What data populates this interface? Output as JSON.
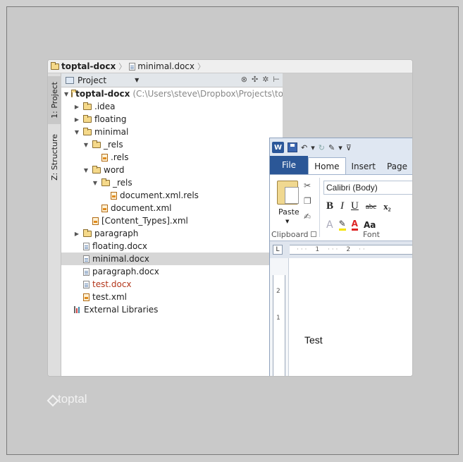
{
  "breadcrumb": {
    "project": "toptal-docx",
    "file": "minimal.docx"
  },
  "toolstrip": {
    "project_tab": "1: Project",
    "structure_tab": "Z: Structure"
  },
  "project_panel": {
    "title": "Project",
    "tree": [
      {
        "label": "toptal-docx",
        "path": "(C:\\Users\\steve\\Dropbox\\Projects\\topt",
        "kind": "folder",
        "expanded": true,
        "indent": 0
      },
      {
        "label": ".idea",
        "kind": "folder",
        "expanded": false,
        "indent": 1
      },
      {
        "label": "floating",
        "kind": "folder",
        "expanded": false,
        "indent": 1
      },
      {
        "label": "minimal",
        "kind": "folder",
        "expanded": true,
        "indent": 1
      },
      {
        "label": "_rels",
        "kind": "folder",
        "expanded": true,
        "indent": 2
      },
      {
        "label": ".rels",
        "kind": "xml",
        "indent": 3
      },
      {
        "label": "word",
        "kind": "folder",
        "expanded": true,
        "indent": 2
      },
      {
        "label": "_rels",
        "kind": "folder",
        "expanded": true,
        "indent": 3
      },
      {
        "label": "document.xml.rels",
        "kind": "xml",
        "indent": 4
      },
      {
        "label": "document.xml",
        "kind": "xml",
        "indent": 3
      },
      {
        "label": "[Content_Types].xml",
        "kind": "xml",
        "indent": 2
      },
      {
        "label": "paragraph",
        "kind": "folder",
        "expanded": false,
        "indent": 1
      },
      {
        "label": "floating.docx",
        "kind": "file",
        "indent": 1
      },
      {
        "label": "minimal.docx",
        "kind": "file",
        "indent": 1,
        "selected": true
      },
      {
        "label": "paragraph.docx",
        "kind": "file",
        "indent": 1
      },
      {
        "label": "test.docx",
        "kind": "file",
        "indent": 1,
        "color": "#b3361b"
      },
      {
        "label": "test.xml",
        "kind": "xml",
        "indent": 1
      },
      {
        "label": "External Libraries",
        "kind": "lib",
        "indent": 0
      }
    ]
  },
  "word": {
    "logo": "W",
    "tabs": {
      "file": "File",
      "home": "Home",
      "insert": "Insert",
      "page": "Page"
    },
    "clipboard": {
      "paste": "Paste",
      "group": "Clipboard"
    },
    "font": {
      "name": "Calibri (Body)",
      "group": "Font",
      "bold": "B",
      "italic": "I",
      "underline": "U",
      "strike": "abc",
      "subscript": "x₂",
      "size": "Aa"
    },
    "ruler": [
      "1",
      "2"
    ],
    "vruler": [
      "2",
      "1"
    ],
    "document_text": "Test"
  },
  "brand": "toptal"
}
